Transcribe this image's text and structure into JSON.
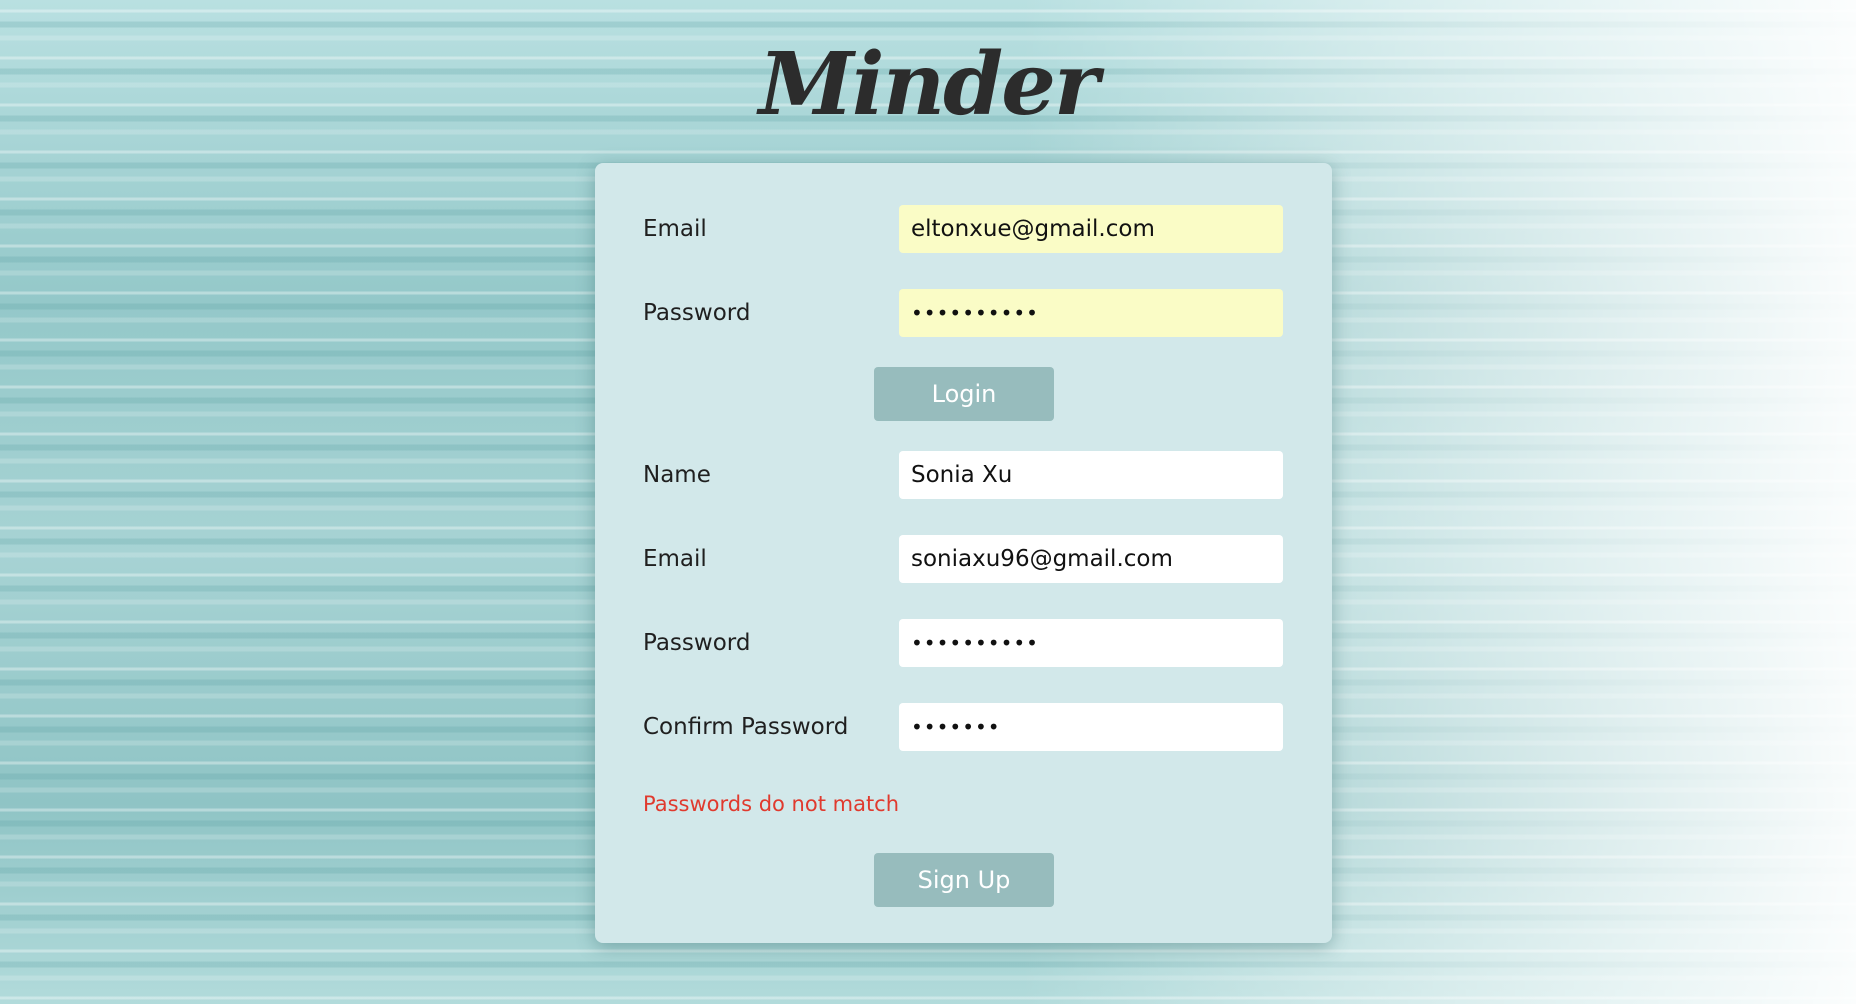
{
  "app": {
    "logo": "Minder"
  },
  "login": {
    "email_label": "Email",
    "email_value": "eltonxue@gmail.com",
    "password_label": "Password",
    "password_value": "abcdefghij",
    "login_button": "Login"
  },
  "signup": {
    "name_label": "Name",
    "name_value": "Sonia Xu",
    "email_label": "Email",
    "email_value": "soniaxu96@gmail.com",
    "password_label": "Password",
    "password_value": "abcdefghij",
    "confirm_label": "Confirm Password",
    "confirm_value": "abcdefg",
    "error_message": "Passwords do not match",
    "signup_button": "Sign Up"
  }
}
